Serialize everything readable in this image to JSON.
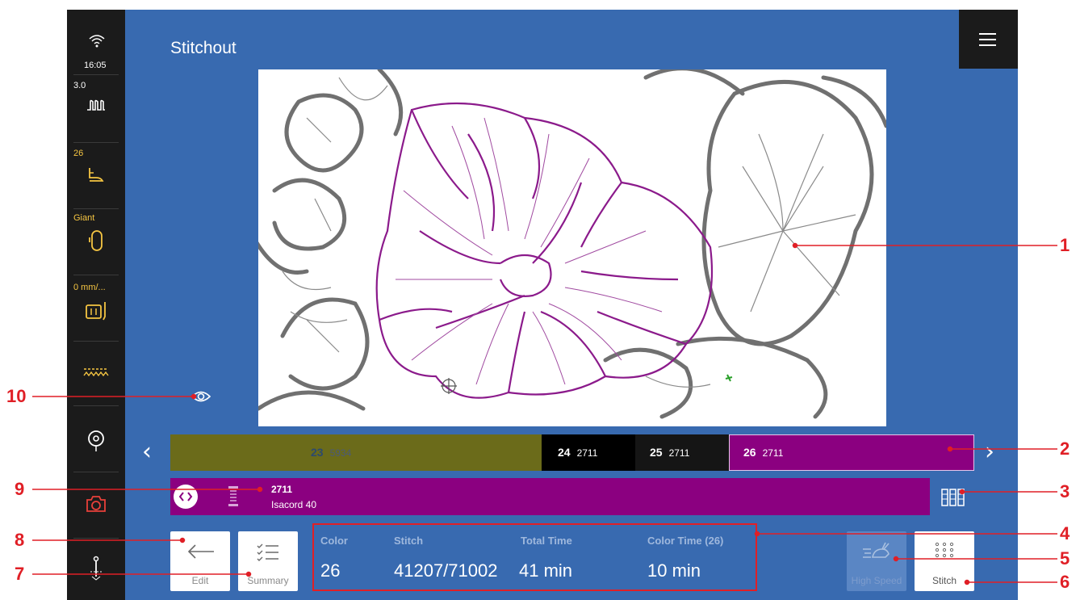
{
  "screen": {
    "title": "Stitchout"
  },
  "sidebar": {
    "time": "16:05",
    "stitch_length": "3.0",
    "presser_foot": "26",
    "hoop": "Giant",
    "feed": "0 mm/..."
  },
  "color_bar": [
    {
      "num": "23",
      "code": "5934",
      "color": "#6b6b1a"
    },
    {
      "num": "24",
      "code": "2711",
      "color": "#000000"
    },
    {
      "num": "25",
      "code": "2711",
      "color": "#151515"
    },
    {
      "num": "26",
      "code": "2711",
      "color": "#8b0080",
      "selected": true
    }
  ],
  "thread": {
    "code": "2711",
    "brand": "Isacord 40"
  },
  "info": {
    "color_label": "Color",
    "color_value": "26",
    "stitch_label": "Stitch",
    "stitch_value": "41207/71002",
    "total_label": "Total Time",
    "total_value": "41 min",
    "colortime_label": "Color Time (26)",
    "colortime_value": "10 min"
  },
  "buttons": {
    "edit": "Edit",
    "summary": "Summary",
    "speed": "High Speed",
    "stitch": "Stitch"
  },
  "callouts": [
    "1",
    "2",
    "3",
    "4",
    "5",
    "6",
    "7",
    "8",
    "9",
    "10"
  ],
  "colors": {
    "accent_red": "#e01f26",
    "screen_blue": "#386ab0",
    "thread_magenta": "#8b0080",
    "status_yellow": "#f5c542"
  }
}
